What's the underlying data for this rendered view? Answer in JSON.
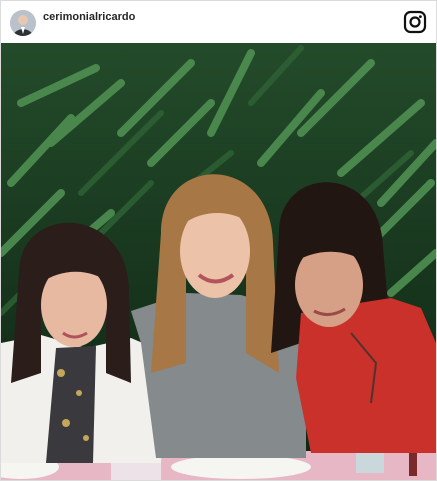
{
  "post": {
    "username": "cerimonialricardo",
    "profile_icon": "profile-avatar",
    "brand_icon": "instagram-icon"
  },
  "photo": {
    "subject": "three-women-portrait",
    "colors": {
      "foliage_dark": "#173a20",
      "foliage_light": "#4f8f52",
      "left_blazer": "#f1f0ec",
      "middle_sweater": "#858a8c",
      "right_top": "#c9312a",
      "table_pink": "#e8b7c6"
    }
  }
}
